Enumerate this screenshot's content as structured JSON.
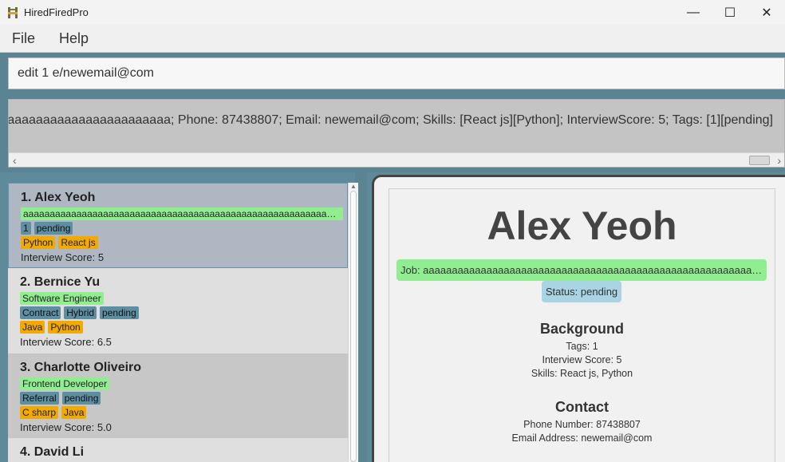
{
  "window": {
    "title": "HiredFiredPro",
    "minimize": "—",
    "maximize": "☐",
    "close": "✕"
  },
  "menu": {
    "file": "File",
    "help": "Help"
  },
  "command": {
    "value": "edit 1 e/newemail@com"
  },
  "result": {
    "text": "aaaaaaaaaaaaaaaaaaaaaaaa; Phone: 87438807; Email: newemail@com; Skills: [React js][Python]; InterviewScore: 5; Tags: [1][pending]"
  },
  "persons": [
    {
      "name": "1.  Alex Yeoh",
      "job": "aaaaaaaaaaaaaaaaaaaaaaaaaaaaaaaaaaaaaaaaaaaaaaaaaaaaaaaaaaaaaaaaaaaaaaa...",
      "tags": [
        "1",
        "pending"
      ],
      "skills": [
        "Python",
        "React js"
      ],
      "score": "Interview Score: 5"
    },
    {
      "name": "2.  Bernice Yu",
      "job": "Software Engineer",
      "tags": [
        "Contract",
        "Hybrid",
        "pending"
      ],
      "skills": [
        "Java",
        "Python"
      ],
      "score": "Interview Score: 6.5"
    },
    {
      "name": "3.  Charlotte Oliveiro",
      "job": "Frontend Developer",
      "tags": [
        "Referral",
        "pending"
      ],
      "skills": [
        "C sharp",
        "Java"
      ],
      "score": "Interview Score: 5.0"
    },
    {
      "name": "4.  David Li"
    }
  ],
  "detail": {
    "name": "Alex Yeoh",
    "job": "Job: aaaaaaaaaaaaaaaaaaaaaaaaaaaaaaaaaaaaaaaaaaaaaaaaaaaaaaaaaaaaaaaaaaaa...",
    "status": "Status: pending",
    "background_title": "Background",
    "tags": "Tags: 1",
    "score": "Interview Score: 5",
    "skills": "Skills: React js, Python",
    "contact_title": "Contact",
    "phone": "Phone Number: 87438807",
    "email": "Email Address: newemail@com"
  },
  "colors": {
    "accent": "#5b8493",
    "job_tag": "#90ee90",
    "tag": "#5e8ea2",
    "skill": "#f2a900",
    "status": "#a8d4e4"
  },
  "icons": {
    "app": "app-icon",
    "scroll_left": "chevron-left-icon",
    "scroll_right": "chevron-right-icon"
  }
}
